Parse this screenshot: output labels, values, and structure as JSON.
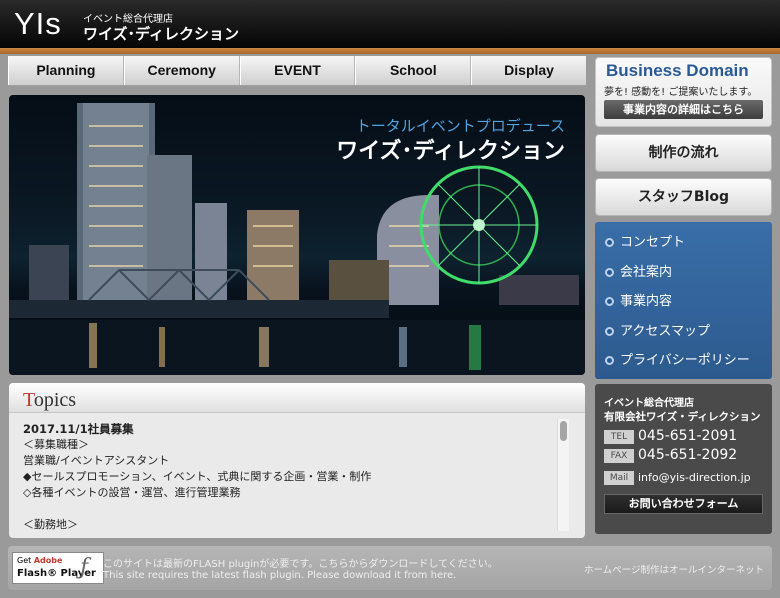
{
  "header": {
    "logo": "YIs",
    "tagline": "イベント総合代理店",
    "company": "ワイズ･ディレクション"
  },
  "nav": {
    "tabs": [
      "Planning",
      "Ceremony",
      "EVENT",
      "School",
      "Display"
    ]
  },
  "hero": {
    "subtitle": "トータルイベントプロデュース",
    "title": "ワイズ･ディレクション"
  },
  "topics": {
    "title_first": "T",
    "title_rest": "opics",
    "lines": [
      "2017.11/1社員募集",
      "＜募集職種＞",
      "営業職/イベントアシスタント",
      "◆セールスプロモーション、イベント、式典に関する企画・営業・制作",
      "◇各種イベントの設営・運営、進行管理業務",
      "",
      "＜勤務地＞"
    ]
  },
  "sidebar": {
    "business": {
      "title": "Business Domain",
      "subtitle": "夢を! 感動を! ご提案いたします。",
      "button": "事業内容の詳細はこちら"
    },
    "flow_button": "制作の流れ",
    "blog_button": "スタッフBlog",
    "menu": [
      "コンセプト",
      "会社案内",
      "事業内容",
      "アクセスマップ",
      "プライバシーポリシー"
    ],
    "contact": {
      "tagline": "イベント総合代理店",
      "company": "有限会社ワイズ・ディレクション",
      "tel_label": "TEL",
      "tel": "045-651-2091",
      "fax_label": "FAX",
      "fax": "045-651-2092",
      "mail_label": "Mail",
      "mail": "info@yis-direction.jp",
      "button": "お問い合わせフォーム"
    }
  },
  "footer": {
    "flash_get": "Get",
    "flash_adobe": "Adobe",
    "flash_player": "Flash® Player",
    "notice_jp": "このサイトは最新のFLASH pluginが必要です。こちらからダウンロードしてください。",
    "notice_en": "This site requires the latest flash plugin. Please download it from here.",
    "credit": "ホームページ制作はオールインターネット"
  },
  "colors": {
    "accent_blue": "#2a5a96",
    "header_bar": "#c9873f",
    "topics_red": "#c03a2b"
  }
}
